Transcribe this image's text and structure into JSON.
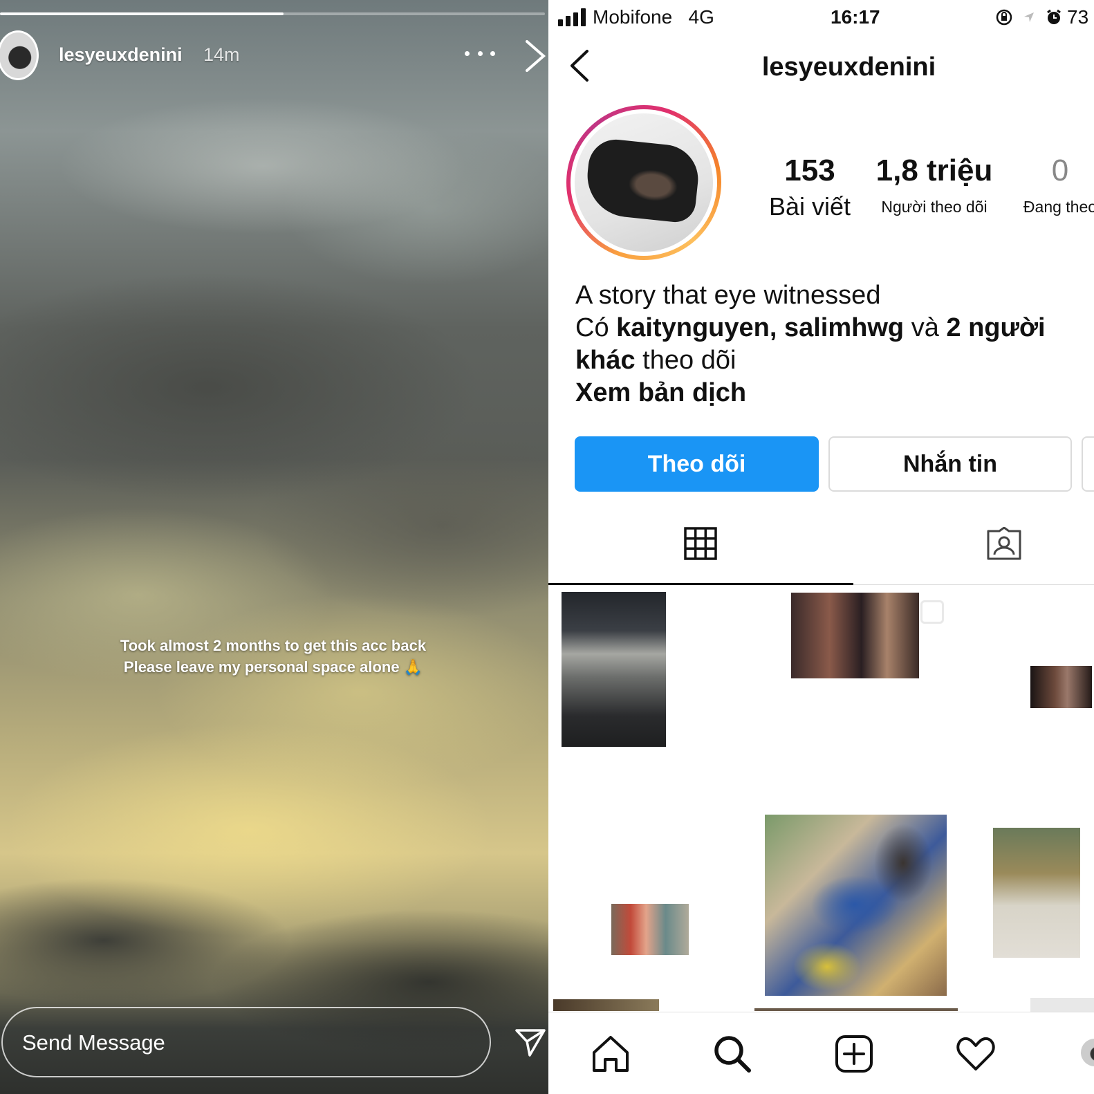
{
  "story": {
    "progress_fraction": 0.52,
    "username": "lesyeuxdenini",
    "time_ago": "14m",
    "caption_line1": "Took almost 2 months to get this acc back",
    "caption_line2": "Please leave my personal space alone 🙏",
    "send_placeholder": "Send Message",
    "icons": [
      "more-icon",
      "close-icon",
      "send-icon"
    ]
  },
  "profile": {
    "status_bar": {
      "carrier": "Mobifone",
      "network": "4G",
      "time": "16:17",
      "battery": "73"
    },
    "username": "lesyeuxdenini",
    "stats": {
      "posts_count": "153",
      "posts_label": "Bài viết",
      "followers_count": "1,8 triệu",
      "followers_label": "Người theo dõi",
      "following_count": "0",
      "following_label": "Đang theo"
    },
    "bio": {
      "line1": "A story that eye witnessed",
      "followed_by_prefix": "Có ",
      "followed_by_names": "kaitynguyen, salimhwg",
      "followed_by_and": " và ",
      "followed_by_others": "2 người khác",
      "followed_by_suffix": " theo dõi",
      "translate": "Xem bản dịch"
    },
    "buttons": {
      "follow": "Theo dõi",
      "message": "Nhắn tin"
    },
    "accent_color": "#1a95f5",
    "tabs": [
      "grid-icon",
      "tagged-icon"
    ],
    "bottom_nav": [
      "home-icon",
      "search-icon",
      "new-post-icon",
      "heart-icon",
      "profile-icon"
    ]
  }
}
